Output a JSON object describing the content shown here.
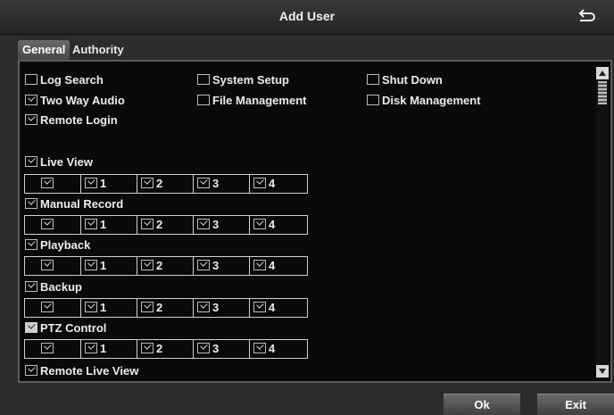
{
  "window": {
    "title": "Add User",
    "back_icon": "return-arrow-icon"
  },
  "tabs": [
    {
      "label": "General",
      "active": true
    },
    {
      "label": "Authority",
      "active": false
    }
  ],
  "permissions": {
    "log_search": {
      "label": "Log Search",
      "checked": false
    },
    "system_setup": {
      "label": "System Setup",
      "checked": false
    },
    "shut_down": {
      "label": "Shut Down",
      "checked": false
    },
    "two_way_audio": {
      "label": "Two Way Audio",
      "checked": true
    },
    "file_management": {
      "label": "File Management",
      "checked": false
    },
    "disk_management": {
      "label": "Disk Management",
      "checked": false
    },
    "remote_login": {
      "label": "Remote Login",
      "checked": true
    }
  },
  "channel_groups": [
    {
      "label": "Live View",
      "checked": true,
      "channels": [
        "1",
        "2",
        "3",
        "4"
      ]
    },
    {
      "label": "Manual Record",
      "checked": true,
      "channels": [
        "1",
        "2",
        "3",
        "4"
      ]
    },
    {
      "label": "Playback",
      "checked": true,
      "channels": [
        "1",
        "2",
        "3",
        "4"
      ]
    },
    {
      "label": "Backup",
      "checked": true,
      "channels": [
        "1",
        "2",
        "3",
        "4"
      ]
    },
    {
      "label": "PTZ Control",
      "checked": true,
      "highlighted": true,
      "channels": [
        "1",
        "2",
        "3",
        "4"
      ]
    }
  ],
  "remote_live_view": {
    "label": "Remote Live View",
    "checked": true
  },
  "buttons": {
    "ok": "Ok",
    "exit": "Exit"
  }
}
